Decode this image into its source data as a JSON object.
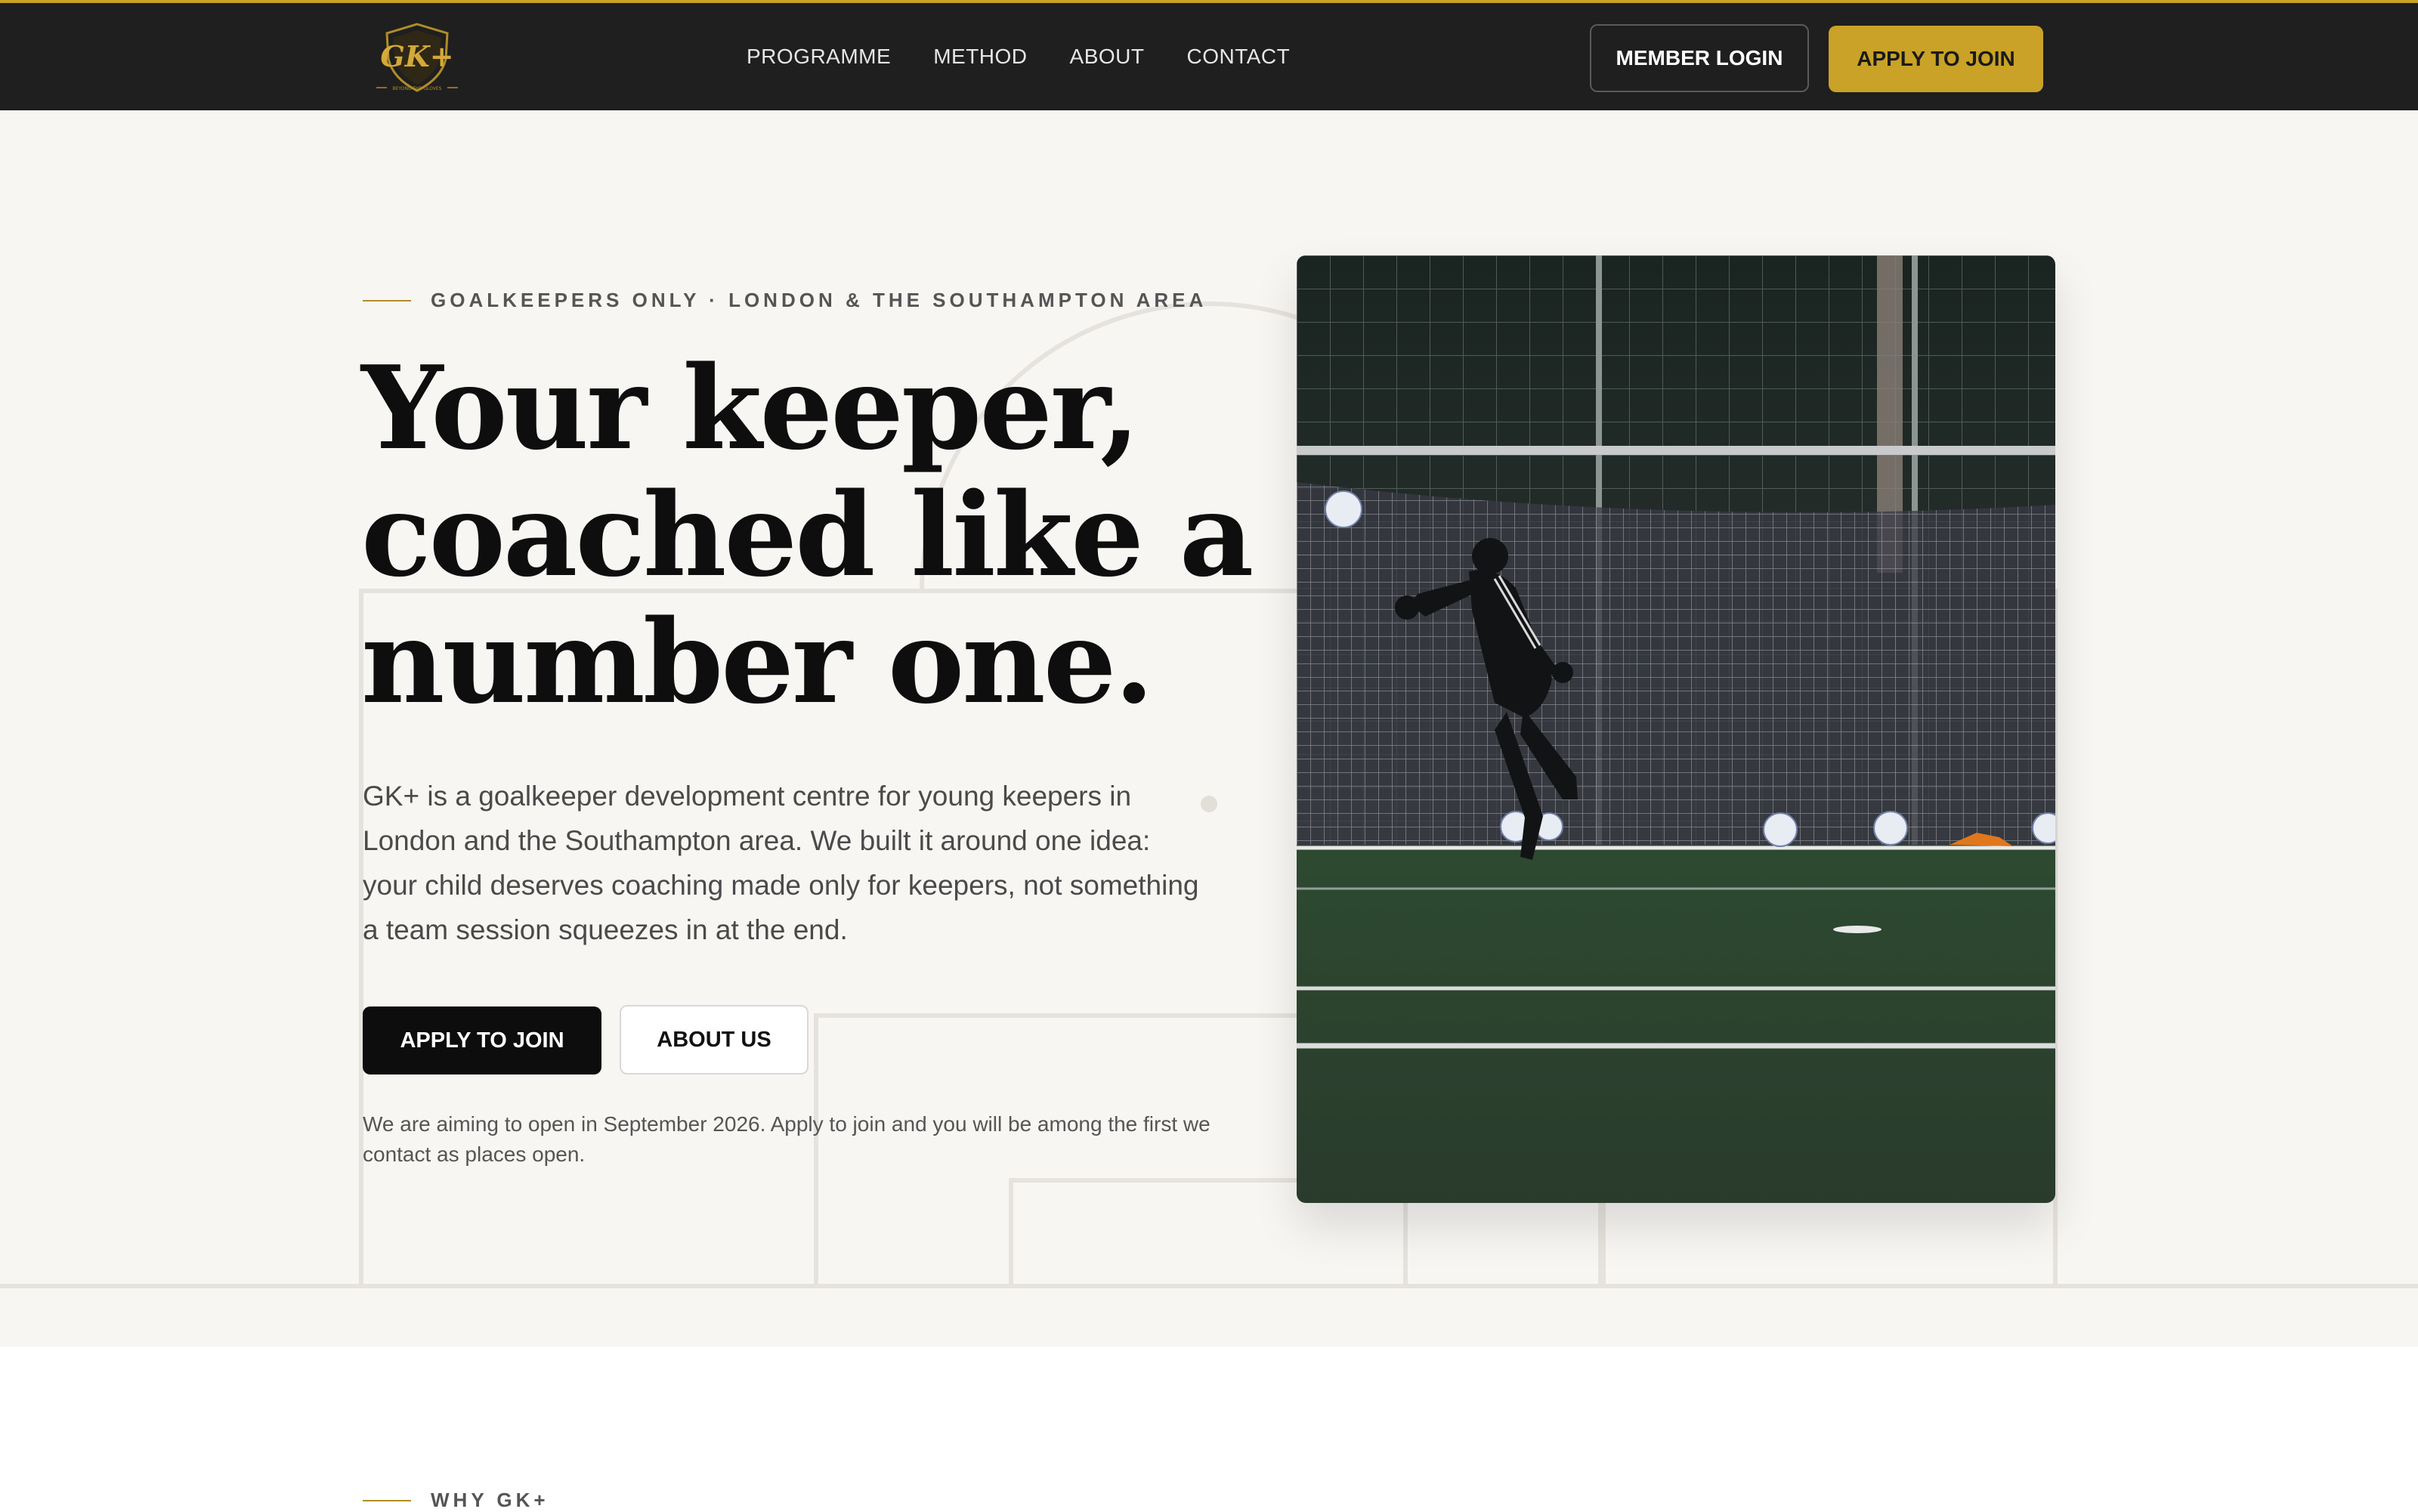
{
  "header": {
    "logo_text": "GK+",
    "logo_tagline": "BEYOND THE GLOVES",
    "nav": [
      {
        "label": "PROGRAMME"
      },
      {
        "label": "METHOD"
      },
      {
        "label": "ABOUT"
      },
      {
        "label": "CONTACT"
      }
    ],
    "member_login": "MEMBER LOGIN",
    "apply": "APPLY TO JOIN"
  },
  "hero": {
    "eyebrow": "GOALKEEPERS ONLY · LONDON & THE SOUTHAMPTON AREA",
    "headline_lines": [
      "Your keeper,",
      "coached like a",
      "number one."
    ],
    "lede": "GK+ is a goalkeeper development centre for young keepers in London and the Southampton area. We built it around one idea: your child deserves coaching made only for keepers, not something a team session squeezes in at the end.",
    "primary_cta": "APPLY TO JOIN",
    "secondary_cta": "ABOUT US",
    "note": "We are aiming to open in September 2026. Apply to join and you will be among the first we contact as places open."
  },
  "why_section": {
    "eyebrow": "WHY GK+"
  },
  "colors": {
    "accent": "#c9a227",
    "header_bg": "#1f1f1f",
    "hero_bg": "#f8f6f3"
  }
}
